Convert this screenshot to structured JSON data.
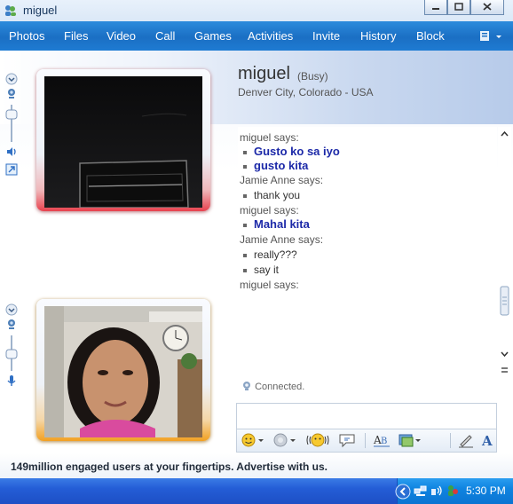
{
  "window": {
    "title": "miguel"
  },
  "menu": [
    "Photos",
    "Files",
    "Video",
    "Call",
    "Games",
    "Activities",
    "Invite",
    "History",
    "Block"
  ],
  "contact": {
    "name": "miguel",
    "status": "(Busy)",
    "location": "Denver City, Colorado - USA"
  },
  "conversation": [
    {
      "kind": "speaker",
      "text": "miguel says:"
    },
    {
      "kind": "message",
      "text": "Gusto ko sa iyo",
      "style": "bold"
    },
    {
      "kind": "message",
      "text": "gusto kita",
      "style": "bold"
    },
    {
      "kind": "speaker",
      "text": "Jamie Anne says:"
    },
    {
      "kind": "message",
      "text": "thank you",
      "style": "normal"
    },
    {
      "kind": "speaker",
      "text": "miguel says:"
    },
    {
      "kind": "message",
      "text": "Mahal kita",
      "style": "bold"
    },
    {
      "kind": "speaker",
      "text": "Jamie Anne says:"
    },
    {
      "kind": "message",
      "text": "really???",
      "style": "normal"
    },
    {
      "kind": "message",
      "text": "say it",
      "style": "normal"
    },
    {
      "kind": "speaker",
      "text": "miguel says:"
    }
  ],
  "connection_status": "Connected.",
  "ad_text": "149million engaged users at your fingertips. Advertise with us.",
  "taskbar": {
    "clock": "5:30 PM"
  },
  "colors": {
    "menubar": "#1b6fc4",
    "bold_message": "#1c29a8",
    "frame_top_glow": "#e8424e",
    "frame_bottom_glow": "#f2a021"
  },
  "icons": {
    "window": "messenger-icon",
    "menu_extra": "toolbar-menu-icon",
    "toolbar": [
      "emoticon-icon",
      "wink-icon",
      "nudge-icon",
      "voice-clip-icon",
      "font-icon",
      "background-icon",
      "handwriting-icon",
      "text-icon"
    ]
  }
}
